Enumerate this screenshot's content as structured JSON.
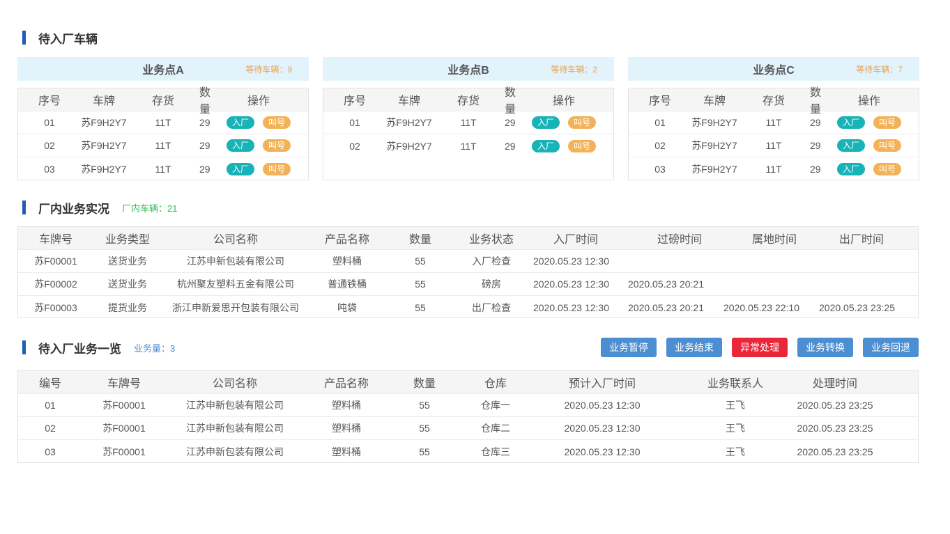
{
  "sections": {
    "pending_vehicles": {
      "title": "待入厂车辆"
    },
    "in_plant": {
      "title": "厂内业务实况",
      "count_label": "厂内车辆：21"
    },
    "pending_business": {
      "title": "待入厂业务一览",
      "count_label": "业务量：3"
    }
  },
  "points": [
    {
      "name": "业务点A",
      "wait_label": "等待车辆：9",
      "headers": [
        "序号",
        "车牌",
        "存货",
        "数量",
        "操作"
      ],
      "rows": [
        {
          "no": "01",
          "plate": "苏F9H2Y7",
          "stock": "11T",
          "qty": "29"
        },
        {
          "no": "02",
          "plate": "苏F9H2Y7",
          "stock": "11T",
          "qty": "29"
        },
        {
          "no": "03",
          "plate": "苏F9H2Y7",
          "stock": "11T",
          "qty": "29"
        }
      ],
      "enter_label": "入厂",
      "call_label": "叫号"
    },
    {
      "name": "业务点B",
      "wait_label": "等待车辆：2",
      "headers": [
        "序号",
        "车牌",
        "存货",
        "数量",
        "操作"
      ],
      "rows": [
        {
          "no": "01",
          "plate": "苏F9H2Y7",
          "stock": "11T",
          "qty": "29"
        },
        {
          "no": "02",
          "plate": "苏F9H2Y7",
          "stock": "11T",
          "qty": "29"
        }
      ],
      "enter_label": "入厂",
      "call_label": "叫号"
    },
    {
      "name": "业务点C",
      "wait_label": "等待车辆：7",
      "headers": [
        "序号",
        "车牌",
        "存货",
        "数量",
        "操作"
      ],
      "rows": [
        {
          "no": "01",
          "plate": "苏F9H2Y7",
          "stock": "11T",
          "qty": "29"
        },
        {
          "no": "02",
          "plate": "苏F9H2Y7",
          "stock": "11T",
          "qty": "29"
        },
        {
          "no": "03",
          "plate": "苏F9H2Y7",
          "stock": "11T",
          "qty": "29"
        }
      ],
      "enter_label": "入厂",
      "call_label": "叫号"
    }
  ],
  "in_plant_table": {
    "headers": [
      "车牌号",
      "业务类型",
      "公司名称",
      "产品名称",
      "数量",
      "业务状态",
      "入厂时间",
      "过磅时间",
      "属地时间",
      "出厂时间"
    ],
    "rows": [
      [
        "苏F00001",
        "送货业务",
        "江苏申新包装有限公司",
        "塑料桶",
        "55",
        "入厂检查",
        "2020.05.23  12:30",
        "",
        "",
        ""
      ],
      [
        "苏F00002",
        "送货业务",
        "杭州聚友塑料五金有限公司",
        "普通铁桶",
        "55",
        "磅房",
        "2020.05.23  12:30",
        "2020.05.23  20:21",
        "",
        ""
      ],
      [
        "苏F00003",
        "提货业务",
        "浙江申新爱思开包装有限公司",
        "吨袋",
        "55",
        "出厂检查",
        "2020.05.23  12:30",
        "2020.05.23  20:21",
        "2020.05.23  22:10",
        "2020.05.23  23:25"
      ]
    ]
  },
  "actions": [
    "业务暂停",
    "业务结束",
    "异常处理",
    "业务转换",
    "业务回退"
  ],
  "pending_table": {
    "headers": [
      "编号",
      "车牌号",
      "公司名称",
      "产品名称",
      "数量",
      "仓库",
      "预计入厂时间",
      "业务联系人",
      "处理时间"
    ],
    "rows": [
      [
        "01",
        "苏F00001",
        "江苏申新包装有限公司",
        "塑料桶",
        "55",
        "仓库一",
        "2020.05.23  12:30",
        "王飞",
        "2020.05.23  23:25"
      ],
      [
        "02",
        "苏F00001",
        "江苏申新包装有限公司",
        "塑料桶",
        "55",
        "仓库二",
        "2020.05.23  12:30",
        "王飞",
        "2020.05.23  23:25"
      ],
      [
        "03",
        "苏F00001",
        "江苏申新包装有限公司",
        "塑料桶",
        "55",
        "仓库三",
        "2020.05.23  12:30",
        "王飞",
        "2020.05.23  23:25"
      ]
    ]
  },
  "colors": {
    "accent_bar": "#1e5fb4",
    "panel_header_bg": "#e2f3fc",
    "wait_label": "#e5a253",
    "in_plant_count": "#2dbb55",
    "business_count": "#4b8ed2",
    "enter_pill": "#17b3b6",
    "call_pill": "#f3b258",
    "button_blue": "#4b8ed2",
    "button_red": "#ea2638"
  }
}
